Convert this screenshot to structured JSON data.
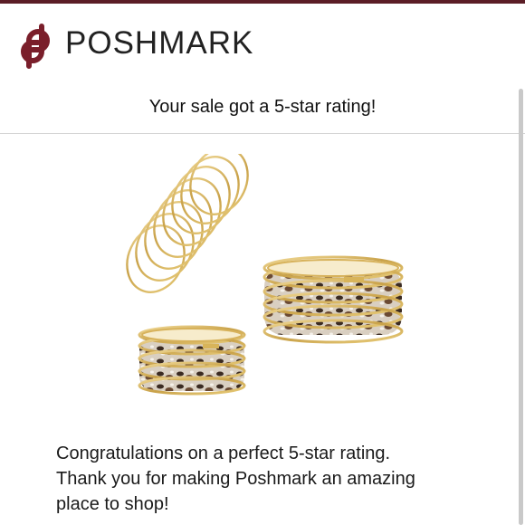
{
  "brand": {
    "name": "POSHMARK",
    "logo_icon": "poshmark-logo-icon",
    "accent_color": "#7a1f2b"
  },
  "notification": {
    "headline": "Your sale got a 5-star rating!",
    "body_line1": "Congratulations on a perfect 5-star rating.",
    "body_line2": "Thank you for making Poshmark an amazing",
    "body_line3": "place to shop!"
  },
  "product_image": {
    "icon": "bangle-bracelets-image"
  }
}
